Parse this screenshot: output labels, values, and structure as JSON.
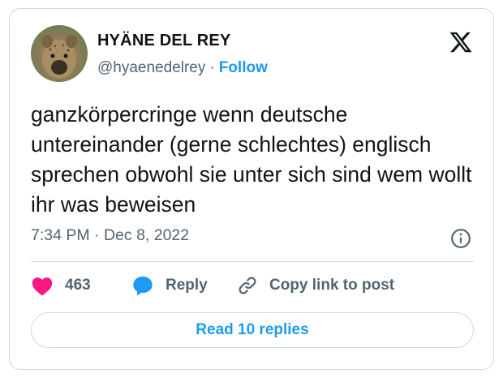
{
  "author": {
    "name": "HYÄNE DEL REY",
    "handle": "@hyaenedelrey",
    "separator": "·",
    "follow_label": "Follow"
  },
  "tweet": {
    "text": "ganzkörpercringe wenn deutsche untereinander (gerne schlechtes) englisch sprechen obwohl sie unter sich sind wem wollt ihr was beweisen",
    "time": "7:34 PM",
    "meta_separator": "·",
    "date": "Dec 8, 2022"
  },
  "actions": {
    "like_count": "463",
    "reply_label": "Reply",
    "copy_label": "Copy link to post"
  },
  "replies_button": "Read 10 replies",
  "colors": {
    "accent": "#1d9bf0",
    "like": "#f91880",
    "text": "#0f1419",
    "muted": "#536471",
    "border": "#cfd9de"
  },
  "icons": {
    "logo": "x-logo-icon",
    "info": "info-icon",
    "like": "heart-icon",
    "reply": "speech-bubble-icon",
    "copy": "link-icon"
  }
}
